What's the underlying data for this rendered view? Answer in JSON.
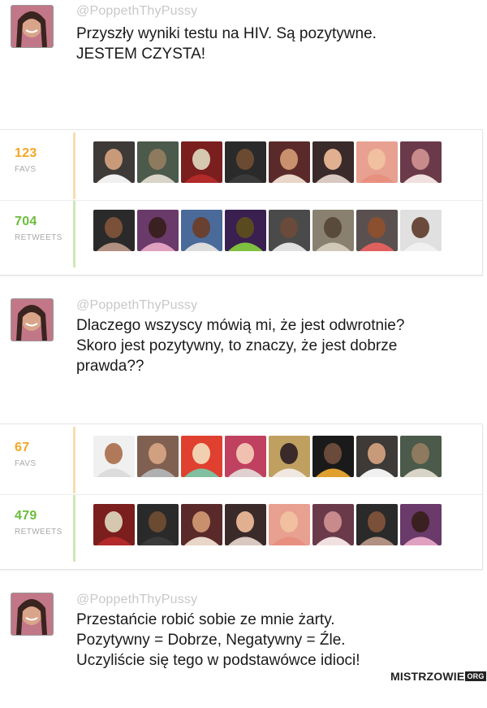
{
  "tweets": [
    {
      "handle": "@PoppethThyPussy",
      "lines": [
        "Przyszły wyniki testu na HIV. Są pozytywne.",
        "JESTEM CZYSTA!"
      ],
      "favs": {
        "count": "123",
        "label": "FAVS"
      },
      "retweets": {
        "count": "704",
        "label": "RETWEETS"
      }
    },
    {
      "handle": "@PoppethThyPussy",
      "lines": [
        "Dlaczego wszyscy mówią mi, że jest odwrotnie?",
        "Skoro jest pozytywny, to znaczy, że jest dobrze",
        "prawda??"
      ],
      "favs": {
        "count": "67",
        "label": "FAVS"
      },
      "retweets": {
        "count": "479",
        "label": "RETWEETS"
      }
    },
    {
      "handle": "@PoppethThyPussy",
      "lines": [
        "Przestańcie robić sobie ze mnie żarty.",
        "Pozytywny = Dobrze, Negatywny = Źle.",
        "Uczyliście się tego w podstawówce idioci!"
      ]
    }
  ],
  "watermark": {
    "brand": "MISTRZOWIE",
    "suffix": "ORG"
  },
  "colors": {
    "favs": "#f5a623",
    "retweets": "#6cbd3c",
    "handle": "#c8c8c8"
  }
}
